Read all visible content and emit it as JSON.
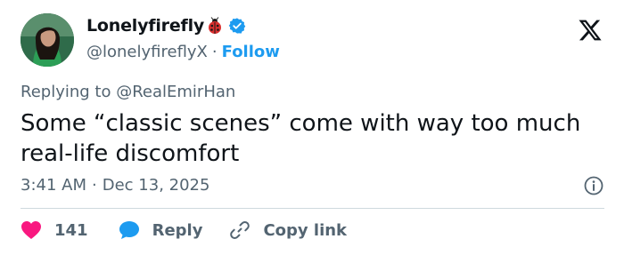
{
  "author": {
    "display_name": "Lonelyfirefly",
    "handle": "@lonelyfireflyX",
    "separator": "·",
    "follow_label": "Follow"
  },
  "reply": {
    "prefix": "Replying to",
    "mention": "@RealEmirHan"
  },
  "tweet": {
    "text": "Some “classic scenes” come with way too much real-life discomfort"
  },
  "meta": {
    "time": "3:41 AM",
    "separator": "·",
    "date": "Dec 13, 2025"
  },
  "actions": {
    "like_count": "141",
    "reply_label": "Reply",
    "copy_label": "Copy link"
  },
  "colors": {
    "accent": "#1d9bf0",
    "like": "#f91880",
    "text": "#0f1419",
    "secondary": "#536471",
    "divider": "#cfd9de"
  },
  "icons": [
    "ladybug-icon",
    "verified-badge-icon",
    "x-logo-icon",
    "info-icon",
    "heart-icon",
    "reply-bubble-icon",
    "link-icon"
  ]
}
